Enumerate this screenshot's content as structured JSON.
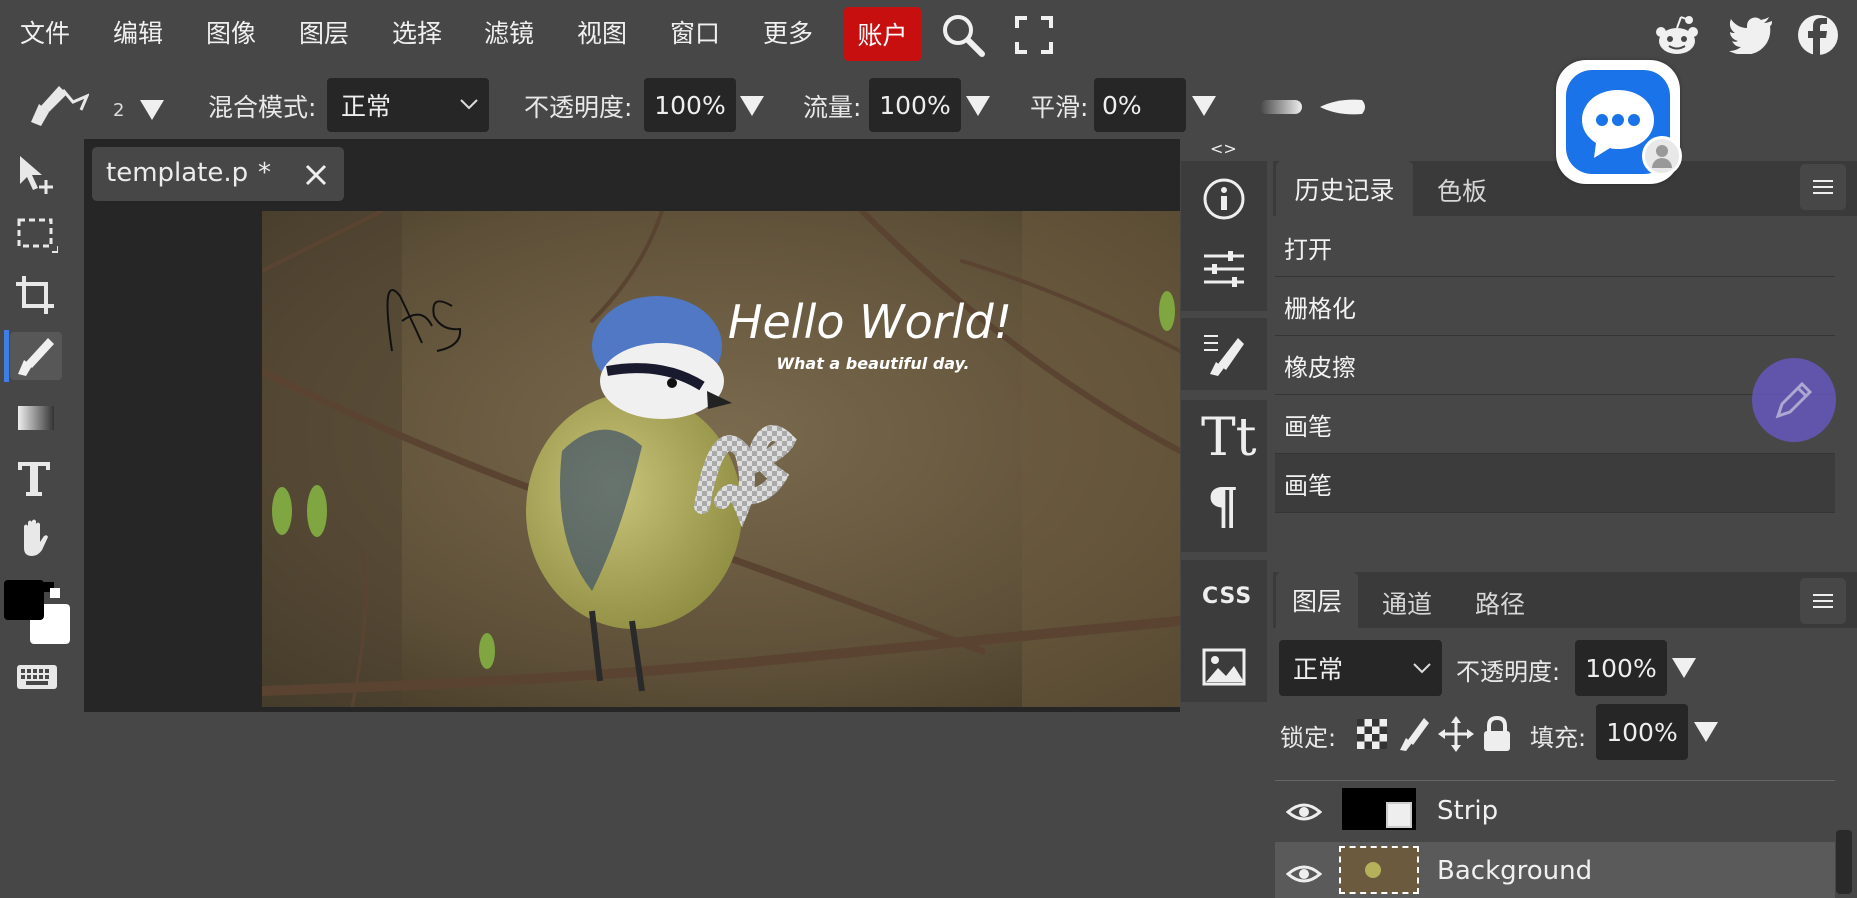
{
  "menu": {
    "items": [
      "文件",
      "编辑",
      "图像",
      "图层",
      "选择",
      "滤镜",
      "视图",
      "窗口",
      "更多"
    ],
    "account": "账户"
  },
  "options": {
    "brush_size": "2",
    "blend_label": "混合模式:",
    "blend_value": "正常",
    "opacity_label": "不透明度:",
    "opacity_value": "100%",
    "flow_label": "流量:",
    "flow_value": "100%",
    "smooth_label": "平滑:",
    "smooth_value": "0%"
  },
  "document": {
    "tab_name": "template.p",
    "tab_modified": "*"
  },
  "canvas": {
    "headline": "Hello World!",
    "subline": "What a beautiful day."
  },
  "history_panel": {
    "tabs": [
      "历史记录",
      "色板"
    ],
    "items": [
      "打开",
      "栅格化",
      "橡皮擦",
      "画笔",
      "画笔"
    ]
  },
  "layers_panel": {
    "tabs": [
      "图层",
      "通道",
      "路径"
    ],
    "blend_value": "正常",
    "opacity_label": "不透明度:",
    "opacity_value": "100%",
    "lock_label": "锁定:",
    "fill_label": "填充:",
    "fill_value": "100%",
    "layers": [
      "Strip",
      "Background"
    ]
  },
  "icon_column": {
    "css_label": "CSS",
    "collapse_arrows": "<>"
  },
  "colors": {
    "background": "#474747",
    "panel_dark": "#262626",
    "account_red": "#c80f0f",
    "tool_active": "#3d7ee8",
    "chat_blue": "#1a73e8",
    "float_purple": "#6a5acd"
  },
  "social_icons": [
    "reddit-icon",
    "twitter-icon",
    "facebook-icon"
  ]
}
